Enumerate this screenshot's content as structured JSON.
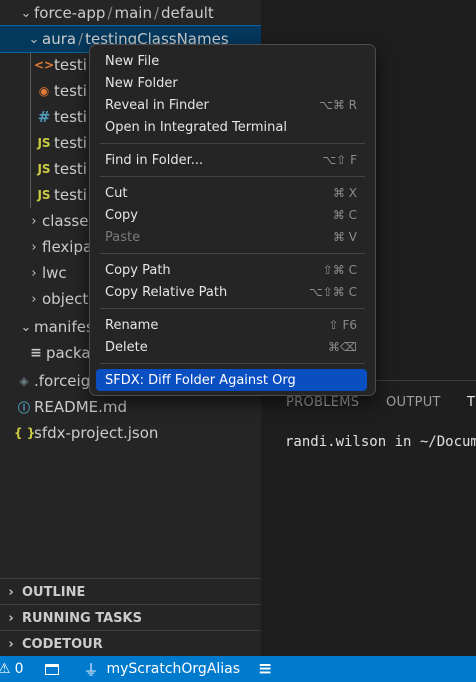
{
  "explorer": {
    "rows": [
      {
        "label": "force-app",
        "path2": "main",
        "path3": "default"
      },
      {
        "label": "aura",
        "path2": "testingClassNames"
      },
      {
        "label": "testi"
      },
      {
        "label": "testi"
      },
      {
        "label": "testi"
      },
      {
        "label": "testi"
      },
      {
        "label": "testi"
      },
      {
        "label": "testi"
      },
      {
        "label": "classe"
      },
      {
        "label": "flexipa"
      },
      {
        "label": "lwc"
      },
      {
        "label": "object"
      },
      {
        "label": "manifes"
      },
      {
        "label": "packa"
      },
      {
        "label": ".forceig"
      },
      {
        "label": "README.md"
      },
      {
        "label": "sfdx-project.json"
      }
    ],
    "sections": [
      "OUTLINE",
      "RUNNING TASKS",
      "CODETOUR"
    ]
  },
  "panel": {
    "tabs": [
      "PROBLEMS",
      "OUTPUT",
      "T"
    ],
    "terminal_text": "randi.wilson in ~/Docume"
  },
  "context_menu": {
    "items": [
      {
        "label": "New File",
        "shortcut": ""
      },
      {
        "label": "New Folder",
        "shortcut": ""
      },
      {
        "label": "Reveal in Finder",
        "shortcut": "⌥⌘ R"
      },
      {
        "label": "Open in Integrated Terminal",
        "shortcut": ""
      },
      {
        "label": "Find in Folder...",
        "shortcut": "⌥⇧ F"
      },
      {
        "label": "Cut",
        "shortcut": "⌘ X"
      },
      {
        "label": "Copy",
        "shortcut": "⌘ C"
      },
      {
        "label": "Paste",
        "shortcut": "⌘ V"
      },
      {
        "label": "Copy Path",
        "shortcut": "⇧⌘ C"
      },
      {
        "label": "Copy Relative Path",
        "shortcut": "⌥⇧⌘ C"
      },
      {
        "label": "Rename",
        "shortcut": "⇧ F6"
      },
      {
        "label": "Delete",
        "shortcut": "⌘⌫"
      },
      {
        "label": "SFDX: Diff Folder Against Org",
        "shortcut": ""
      }
    ]
  },
  "statusbar": {
    "warnings": "0",
    "org_alias": "myScratchOrgAlias"
  },
  "colors": {
    "statusbar": "#007acc",
    "selection": "#04395e",
    "menu_highlight": "#0a4fc1",
    "json_icon": "#cbcb41",
    "html_icon": "#e37933",
    "rss_icon": "#e37933",
    "css_icon": "#519aba",
    "js_icon": "#cbcb41"
  }
}
